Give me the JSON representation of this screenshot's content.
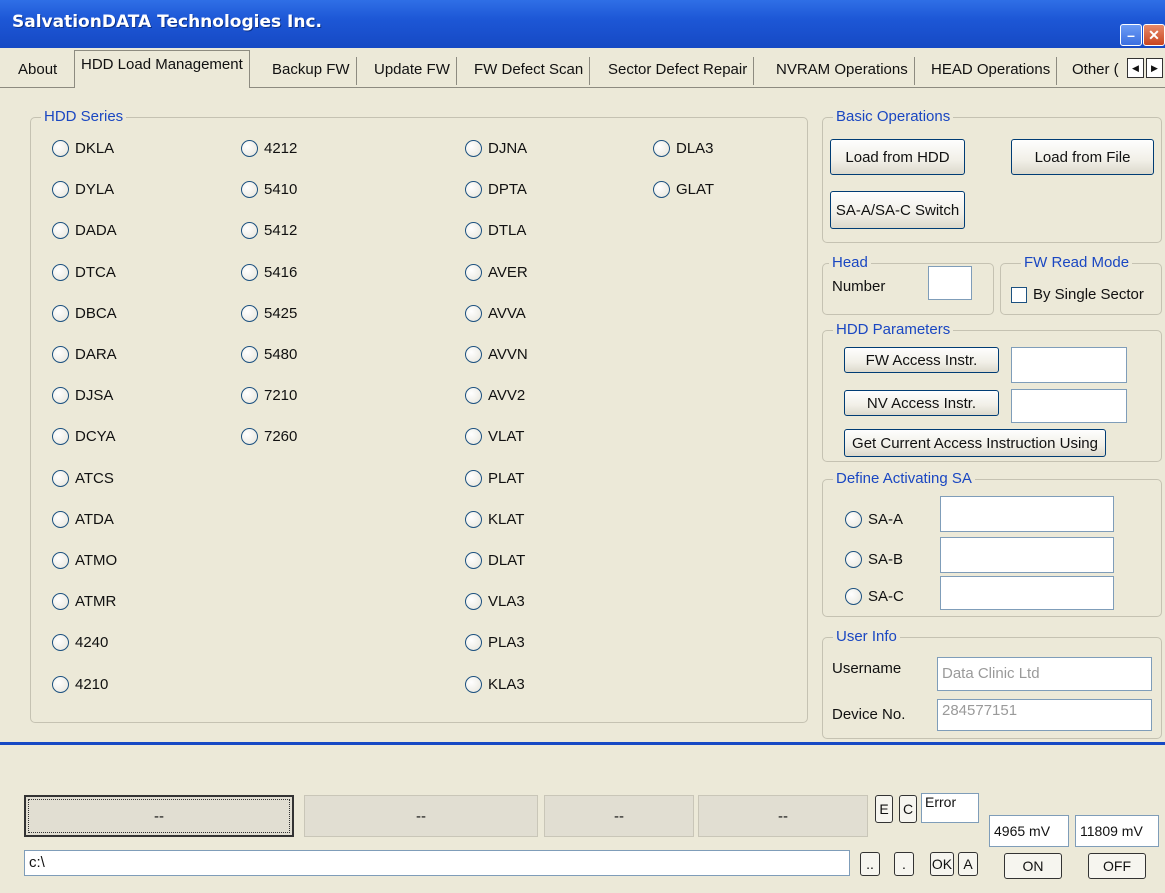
{
  "window": {
    "title": "SalvationDATA Technologies Inc."
  },
  "tabs": [
    {
      "label": "About"
    },
    {
      "label": "HDD Load Management"
    },
    {
      "label": "Backup FW"
    },
    {
      "label": "Update FW"
    },
    {
      "label": "FW Defect Scan"
    },
    {
      "label": "Sector Defect Repair"
    },
    {
      "label": "NVRAM Operations"
    },
    {
      "label": "HEAD Operations"
    },
    {
      "label": "Other ("
    }
  ],
  "hdd_series": {
    "title": "HDD Series",
    "col1": [
      "DKLA",
      "DYLA",
      "DADA",
      "DTCA",
      "DBCA",
      "DARA",
      "DJSA",
      "DCYA",
      "ATCS",
      "ATDA",
      "ATMO",
      "ATMR",
      "4240",
      "4210"
    ],
    "col2": [
      "4212",
      "5410",
      "5412",
      "5416",
      "5425",
      "5480",
      "7210",
      "7260"
    ],
    "col3": [
      "DJNA",
      "DPTA",
      "DTLA",
      "AVER",
      "AVVA",
      "AVVN",
      "AVV2",
      "VLAT",
      "PLAT",
      "KLAT",
      "DLAT",
      "VLA3",
      "PLA3",
      "KLA3"
    ],
    "col4": [
      "DLA3",
      "GLAT"
    ]
  },
  "basic_ops": {
    "title": "Basic Operations",
    "load_hdd": "Load from HDD",
    "load_file": "Load from File",
    "switch": "SA-A/SA-C Switch"
  },
  "head": {
    "title": "Head",
    "number_label": "Number",
    "number_value": ""
  },
  "fw_read_mode": {
    "title": "FW Read Mode",
    "by_single_sector": "By Single Sector",
    "checked": false
  },
  "hdd_params": {
    "title": "HDD Parameters",
    "fw_access": "FW Access Instr.",
    "fw_access_value": "",
    "nv_access": "NV Access Instr.",
    "nv_access_value": "",
    "get_current": "Get Current Access Instruction Using"
  },
  "define_sa": {
    "title": "Define Activating SA",
    "options": [
      {
        "label": "SA-A",
        "value": ""
      },
      {
        "label": "SA-B",
        "value": ""
      },
      {
        "label": "SA-C",
        "value": ""
      }
    ]
  },
  "user_info": {
    "title": "User Info",
    "username_label": "Username",
    "username_value": "Data Clinic Ltd",
    "device_label": "Device No.",
    "device_value": "284577151"
  },
  "bottom": {
    "progress_buttons": [
      "--",
      "--",
      "--",
      "--"
    ],
    "e_label": "E",
    "c_label": "C",
    "status_text": "Error",
    "voltage_1": "4965 mV",
    "voltage_2": "11809 mV",
    "on_label": "ON",
    "off_label": "OFF",
    "path_value": "c:\\",
    "small_btn_1": "..",
    "small_btn_2": ".",
    "ok_label": "OK",
    "a_label": "A"
  },
  "colors": {
    "accent": "#1649c4",
    "legend": "#1a47c2",
    "face": "#ece9d8"
  }
}
